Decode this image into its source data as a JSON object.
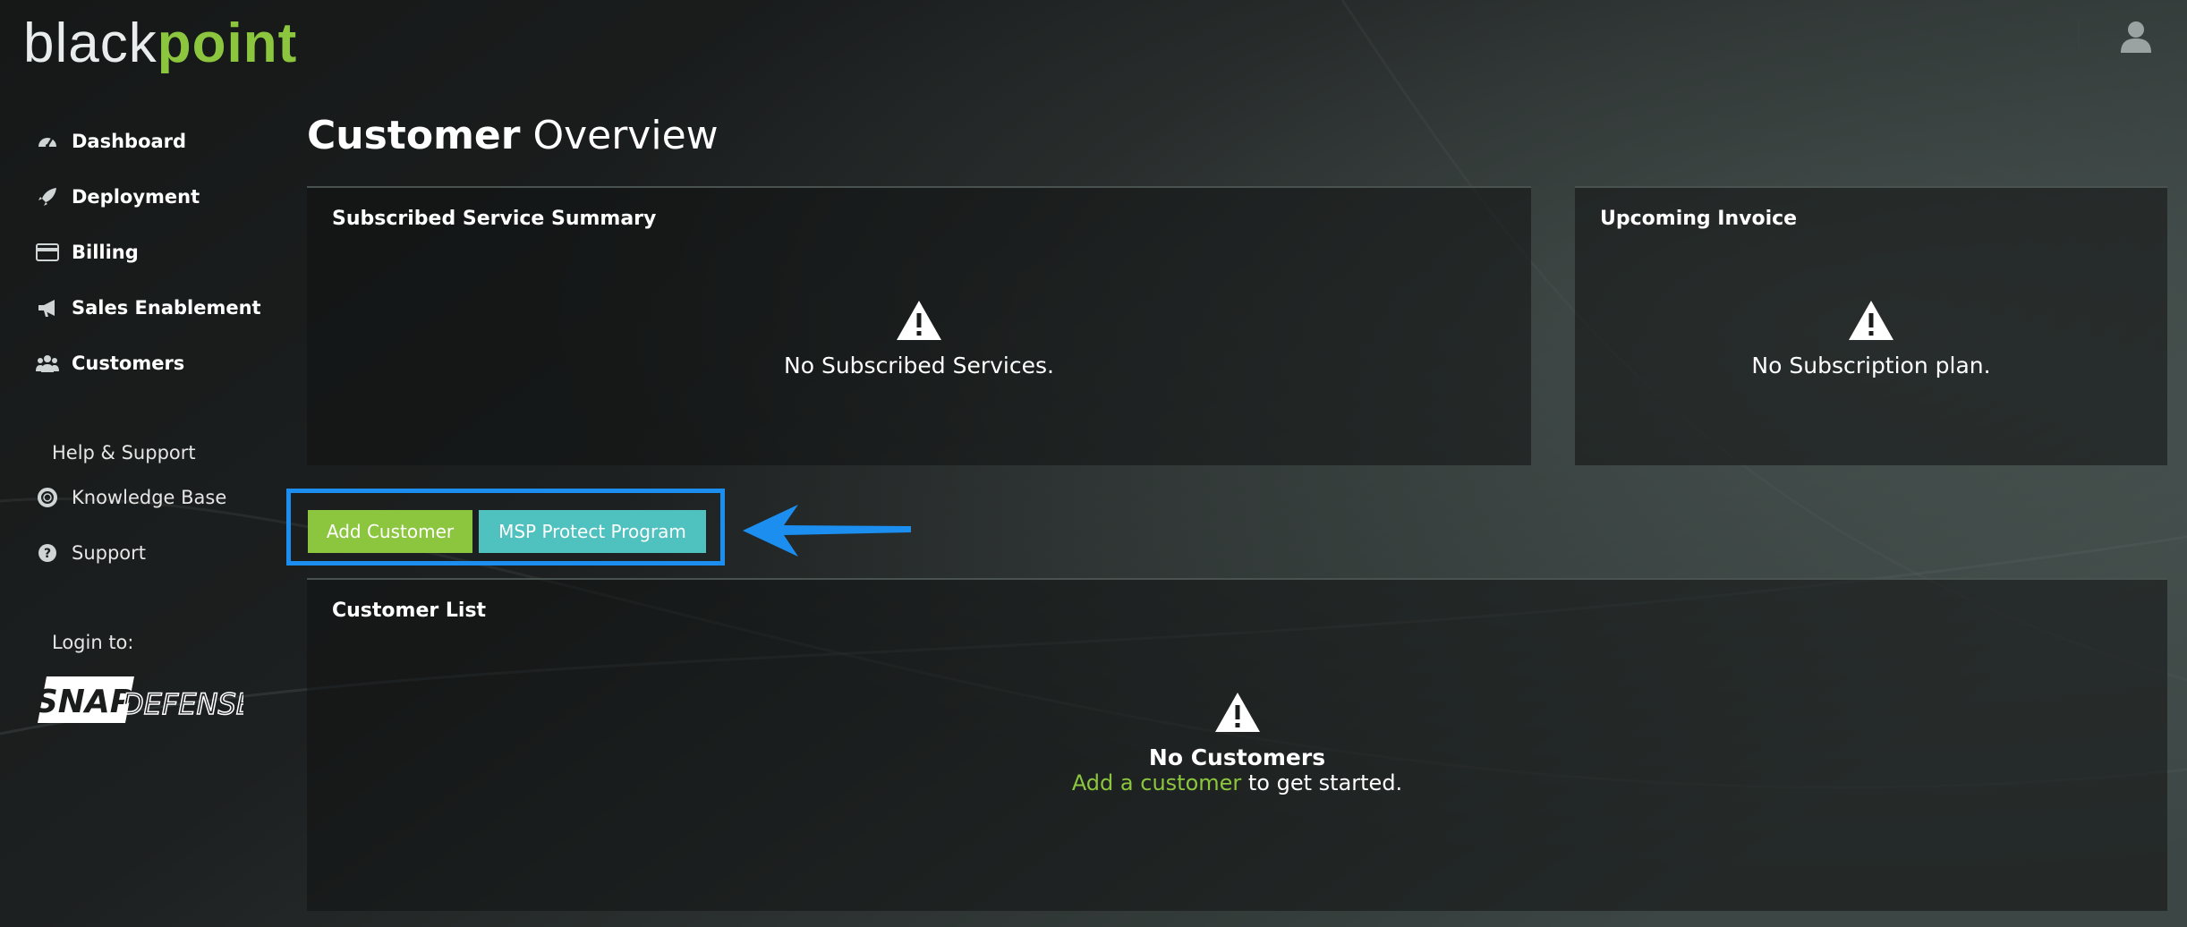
{
  "header": {
    "logo_part1": "black",
    "logo_part2": "point",
    "user_icon": "user-icon"
  },
  "sidebar": {
    "nav": [
      {
        "label": "Dashboard",
        "icon": "dashboard-gauge-icon"
      },
      {
        "label": "Deployment",
        "icon": "rocket-icon"
      },
      {
        "label": "Billing",
        "icon": "credit-card-icon"
      },
      {
        "label": "Sales Enablement",
        "icon": "megaphone-icon"
      },
      {
        "label": "Customers",
        "icon": "users-icon"
      }
    ],
    "help_heading": "Help & Support",
    "help_items": [
      {
        "label": "Knowledge Base",
        "icon": "life-ring-icon"
      },
      {
        "label": "Support",
        "icon": "question-circle-icon"
      }
    ],
    "login_heading": "Login to:",
    "login_logo_part1": "SNAP",
    "login_logo_part2": "DEFENSE"
  },
  "page": {
    "title_bold": "Customer",
    "title_light": "Overview"
  },
  "panels": {
    "subscribed": {
      "title": "Subscribed Service Summary",
      "message": "No Subscribed Services."
    },
    "invoice": {
      "title": "Upcoming Invoice",
      "message": "No Subscription plan."
    },
    "customer_list": {
      "title": "Customer List",
      "empty_title": "No Customers",
      "empty_link": "Add a customer",
      "empty_suffix": " to get started."
    }
  },
  "actions": {
    "add_customer": "Add Customer",
    "msp_program": "MSP Protect Program"
  },
  "colors": {
    "brand_green": "#8cc63f",
    "teal": "#4fc1bf",
    "annotation_blue": "#1b8ef0"
  }
}
